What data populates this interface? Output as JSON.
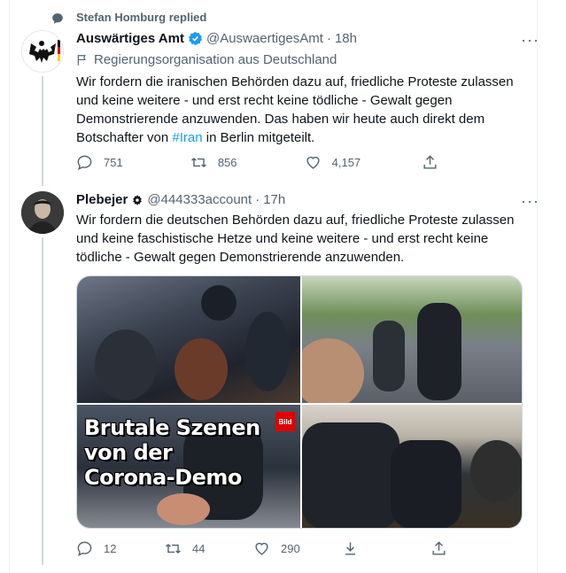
{
  "context": {
    "replied_text": "Stefan Homburg replied"
  },
  "tweet1": {
    "name": "Auswärtiges Amt",
    "handle": "@AuswaertigesAmt",
    "separator": "·",
    "time": "18h",
    "more": "···",
    "org_label": "Regierungsorganisation aus Deutschland",
    "text_before": "Wir fordern die iranischen Behörden dazu auf, friedliche Proteste zulassen und keine weitere - und erst recht keine tödliche - Gewalt gegen Demonstrierende anzuwenden. Das haben wir heute auch direkt dem Botschafter von ",
    "hashtag": "#Iran",
    "text_after": " in Berlin mitgeteilt.",
    "replies": "751",
    "retweets": "856",
    "likes": "4,157"
  },
  "tweet2": {
    "name": "Plebejer",
    "handle": "@444333account",
    "separator": "·",
    "time": "17h",
    "more": "···",
    "text": "Wir fordern die deutschen Behörden dazu auf, friedliche Proteste zulassen und keine faschistische Hetze und keine weitere - und erst recht keine tödliche - Gewalt gegen Demonstrierende anzuwenden.",
    "media_headline_1": "Brutale Szenen",
    "media_headline_2": "von der",
    "media_headline_3": "Corona-Demo",
    "media_logo": "Bild",
    "replies": "12",
    "retweets": "44",
    "likes": "290"
  },
  "colors": {
    "accent": "#1d9bf0",
    "muted": "#536471",
    "text": "#0f1419",
    "verified": "#1d9bf0"
  }
}
